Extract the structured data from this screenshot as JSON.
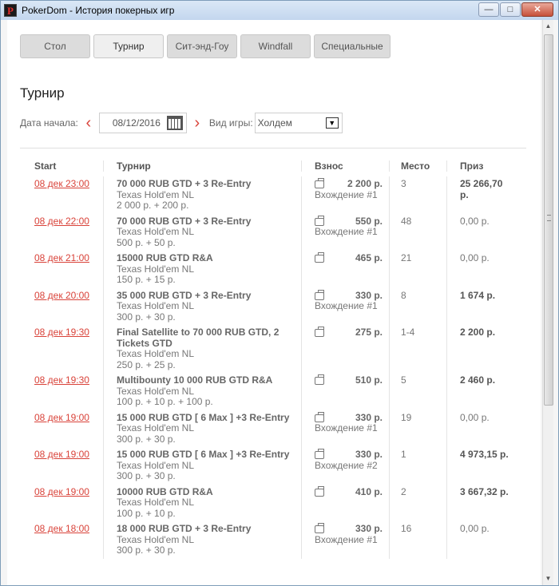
{
  "window": {
    "title": "PokerDom - История покерных игр",
    "icon_letter": "P"
  },
  "tabs": [
    {
      "label": "Стол",
      "width": 88,
      "active": false
    },
    {
      "label": "Турнир",
      "width": 88,
      "active": true
    },
    {
      "label": "Сит-энд-Гоу",
      "width": 88,
      "active": false
    },
    {
      "label": "Windfall",
      "width": 88,
      "active": false
    },
    {
      "label": "Специальные",
      "width": 96,
      "active": false
    }
  ],
  "page_title": "Турнир",
  "filters": {
    "date_label": "Дата начала:",
    "date_value": "08/12/2016",
    "game_label": "Вид игры:",
    "game_value": "Холдем"
  },
  "table": {
    "headers": {
      "start": "Start",
      "name": "Турнир",
      "fee": "Взнос",
      "place": "Место",
      "prize": "Приз"
    },
    "rows": [
      {
        "start": "08 дек 23:00",
        "name": "70 000 RUB GTD + 3 Re-Entry",
        "game": "Texas Hold'em NL",
        "buyin": "2 000 р. + 200 р.",
        "fee": "2 200 р.",
        "entry": "Вхождение #1",
        "place": "3",
        "prize": "25 266,70 р.",
        "prize_bold": true
      },
      {
        "start": "08 дек 22:00",
        "name": "70 000 RUB GTD + 3 Re-Entry",
        "game": "Texas Hold'em NL",
        "buyin": "500 р. + 50 р.",
        "fee": "550 р.",
        "entry": "Вхождение #1",
        "place": "48",
        "prize": "0,00 р.",
        "prize_bold": false
      },
      {
        "start": "08 дек 21:00",
        "name": "15000 RUB GTD R&A",
        "game": "Texas Hold'em NL",
        "buyin": "150 р. + 15 р.",
        "fee": "465 р.",
        "entry": "",
        "place": "21",
        "prize": "0,00 р.",
        "prize_bold": false
      },
      {
        "start": "08 дек 20:00",
        "name": "35 000 RUB GTD + 3 Re-Entry",
        "game": "Texas Hold'em NL",
        "buyin": "300 р. + 30 р.",
        "fee": "330 р.",
        "entry": "Вхождение #1",
        "place": "8",
        "prize": "1 674 р.",
        "prize_bold": true
      },
      {
        "start": "08 дек 19:30",
        "name": "Final Satellite to 70 000 RUB GTD, 2 Tickets GTD",
        "game": "Texas Hold'em NL",
        "buyin": "250 р. + 25 р.",
        "fee": "275 р.",
        "entry": "",
        "place": "1-4",
        "prize": "2 200 р.",
        "prize_bold": true
      },
      {
        "start": "08 дек 19:30",
        "name": "Multibounty 10 000 RUB GTD R&A",
        "game": "Texas Hold'em NL",
        "buyin": "100 р. + 10 р. + 100 р.",
        "fee": "510 р.",
        "entry": "",
        "place": "5",
        "prize": "2 460 р.",
        "prize_bold": true
      },
      {
        "start": "08 дек 19:00",
        "name": "15 000 RUB GTD [ 6 Max ] +3 Re-Entry",
        "game": "Texas Hold'em NL",
        "buyin": "300 р. + 30 р.",
        "fee": "330 р.",
        "entry": "Вхождение #1",
        "place": "19",
        "prize": "0,00 р.",
        "prize_bold": false
      },
      {
        "start": "08 дек 19:00",
        "name": "15 000 RUB GTD [ 6 Max ] +3 Re-Entry",
        "game": "Texas Hold'em NL",
        "buyin": "300 р. + 30 р.",
        "fee": "330 р.",
        "entry": "Вхождение #2",
        "place": "1",
        "prize": "4 973,15 р.",
        "prize_bold": true
      },
      {
        "start": "08 дек 19:00",
        "name": "10000 RUB GTD R&A",
        "game": "Texas Hold'em NL",
        "buyin": "100 р. + 10 р.",
        "fee": "410 р.",
        "entry": "",
        "place": "2",
        "prize": "3 667,32 р.",
        "prize_bold": true
      },
      {
        "start": "08 дек 18:00",
        "name": "18 000 RUB GTD + 3 Re-Entry",
        "game": "Texas Hold'em NL",
        "buyin": "300 р. + 30 р.",
        "fee": "330 р.",
        "entry": "Вхождение #1",
        "place": "16",
        "prize": "0,00 р.",
        "prize_bold": false
      }
    ]
  }
}
